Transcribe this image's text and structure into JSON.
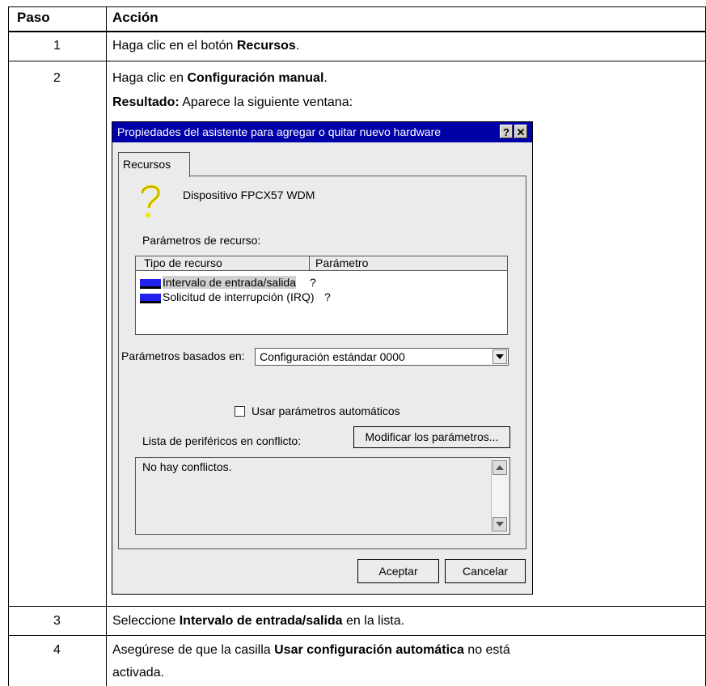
{
  "table": {
    "headers": {
      "step": "Paso",
      "action": "Acción"
    },
    "rows": [
      {
        "step": "1",
        "pre": "Haga clic en el botón ",
        "bold": "Recursos",
        "post": "."
      },
      {
        "step": "2",
        "pre": "Haga clic en ",
        "bold": "Configuración manual",
        "post": ".",
        "result_label": "Resultado:",
        "result_text": " Aparece la siguiente ventana:"
      },
      {
        "step": "3",
        "pre": "Seleccione ",
        "bold": "Intervalo de entrada/salida",
        "post": " en la lista."
      },
      {
        "step": "4",
        "pre": "Asegúrese de que la casilla ",
        "bold": "Usar configuración automática",
        "post": " no está",
        "line2": "activada."
      }
    ]
  },
  "dialog": {
    "title": "Propiedades del asistente para agregar o quitar nuevo hardware",
    "help_button": "?",
    "close_button": "✕",
    "tab": "Recursos",
    "device_name": "Dispositivo FPCX57 WDM",
    "resource_settings_label": "Parámetros de recurso:",
    "columns": {
      "type": "Tipo de recurso",
      "setting": "Parámetro"
    },
    "resources": [
      {
        "type": "Intervalo de entrada/salida",
        "setting": "?"
      },
      {
        "type": "Solicitud de interrupción (IRQ)",
        "setting": "?"
      }
    ],
    "based_on_label": "Parámetros basados en:",
    "based_on_value": "Configuración estándar 0000",
    "auto_settings_label": "Usar parámetros automáticos",
    "auto_settings_checked": false,
    "conflict_label": "Lista de periféricos en conflicto:",
    "change_settings_button": "Modificar los parámetros...",
    "conflict_text": "No hay conflictos.",
    "ok_button": "Aceptar",
    "cancel_button": "Cancelar",
    "colors": {
      "titlebar": "#0000a8",
      "dialog_bg": "#ebebeb",
      "icon": "#2222ee",
      "question_mark": "#f5e400"
    }
  }
}
